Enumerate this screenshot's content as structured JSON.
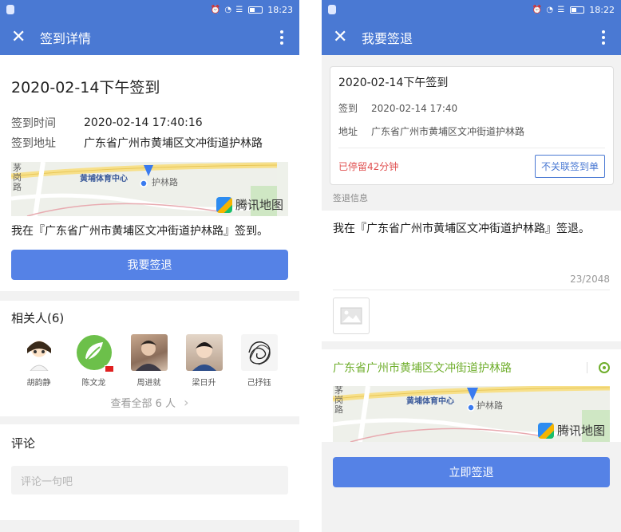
{
  "left": {
    "status_time": "18:23",
    "nav_title": "签到详情",
    "date_title": "2020-02-14下午签到",
    "rows": [
      {
        "key": "签到时间",
        "value": "2020-02-14 17:40:16"
      },
      {
        "key": "签到地址",
        "value": "广东省广州市黄埔区文冲街道护林路"
      }
    ],
    "map": {
      "logo": "腾讯地图",
      "poi": "黄埔体育中心",
      "road": "护林路",
      "road2": "茅岗路"
    },
    "message": "我在『广东省广州市黄埔区文冲街道护林路』签到。",
    "checkout_button": "我要签退",
    "related_title": "相关人(6)",
    "people": [
      {
        "name": "胡韵静"
      },
      {
        "name": "陈文龙"
      },
      {
        "name": "周进就"
      },
      {
        "name": "梁日升"
      },
      {
        "name": "己抒钰"
      }
    ],
    "view_all": "查看全部 6 人",
    "comment_title": "评论",
    "comment_placeholder": "评论一句吧"
  },
  "right": {
    "status_time": "18:22",
    "nav_title": "我要签退",
    "card": {
      "date_title": "2020-02-14下午签到",
      "rows": [
        {
          "key": "签到",
          "value": "2020-02-14 17:40"
        },
        {
          "key": "地址",
          "value": "广东省广州市黄埔区文冲街道护林路"
        }
      ],
      "stay": "已停留42分钟",
      "unlink_button": "不关联签到单"
    },
    "section_label": "签退信息",
    "text": "我在『广东省广州市黄埔区文冲街道护林路』签退。",
    "counter": "23/2048",
    "location": "广东省广州市黄埔区文冲街道护林路",
    "map": {
      "logo": "腾讯地图",
      "poi": "黄埔体育中心",
      "road": "护林路",
      "road2": "茅岗路"
    },
    "submit_button": "立即签退"
  },
  "colors": {
    "primary": "#4a79d3",
    "button": "#5582e6",
    "warning": "#e05151",
    "location": "#6fae2c"
  }
}
